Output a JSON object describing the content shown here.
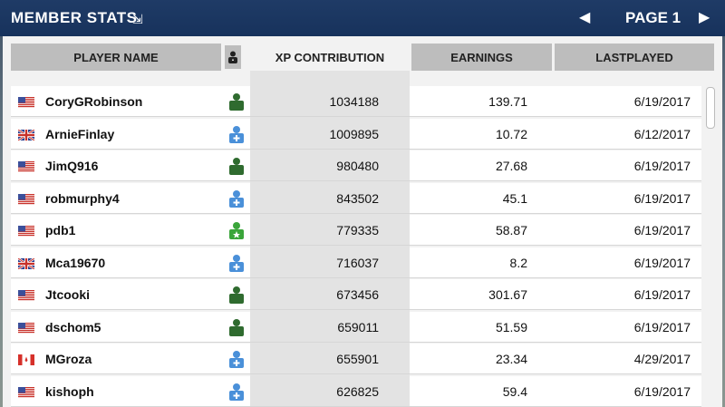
{
  "header": {
    "title": "MEMBER STATS",
    "title_icon": "expand-arrow-icon",
    "page_label": "PAGE 1",
    "prev_icon": "previous-page-icon",
    "next_icon": "next-page-icon"
  },
  "columns": {
    "player_name": "PLAYER NAME",
    "status_icon": "member-status-icon",
    "xp": "XP CONTRIBUTION",
    "earnings": "EARNINGS",
    "last_played": "LASTPLAYED"
  },
  "colors": {
    "topbar": "#1f3b66",
    "header_bg": "#bdbdbd",
    "selected_col": "#e3e3e3",
    "member_green": "#2f6b2f",
    "leader_green": "#3aa53a",
    "recruit_blue": "#4a90d9"
  },
  "rows": [
    {
      "flag": "us-flag-icon",
      "name": "CoryGRobinson",
      "status": "member",
      "xp": "1034188",
      "earnings": "139.71",
      "last": "6/19/2017"
    },
    {
      "flag": "uk-flag-icon",
      "name": "ArnieFinlay",
      "status": "recruit",
      "xp": "1009895",
      "earnings": "10.72",
      "last": "6/12/2017"
    },
    {
      "flag": "us-flag-icon",
      "name": "JimQ916",
      "status": "member",
      "xp": "980480",
      "earnings": "27.68",
      "last": "6/19/2017"
    },
    {
      "flag": "us-flag-icon",
      "name": "robmurphy4",
      "status": "recruit",
      "xp": "843502",
      "earnings": "45.1",
      "last": "6/19/2017"
    },
    {
      "flag": "us-flag-icon",
      "name": "pdb1",
      "status": "leader",
      "xp": "779335",
      "earnings": "58.87",
      "last": "6/19/2017"
    },
    {
      "flag": "uk-flag-icon",
      "name": "Mca19670",
      "status": "recruit",
      "xp": "716037",
      "earnings": "8.2",
      "last": "6/19/2017"
    },
    {
      "flag": "us-flag-icon",
      "name": "Jtcooki",
      "status": "member",
      "xp": "673456",
      "earnings": "301.67",
      "last": "6/19/2017"
    },
    {
      "flag": "us-flag-icon",
      "name": "dschom5",
      "status": "member",
      "xp": "659011",
      "earnings": "51.59",
      "last": "6/19/2017"
    },
    {
      "flag": "ca-flag-icon",
      "name": "MGroza",
      "status": "recruit",
      "xp": "655901",
      "earnings": "23.34",
      "last": "4/29/2017"
    },
    {
      "flag": "us-flag-icon",
      "name": "kishoph",
      "status": "recruit",
      "xp": "626825",
      "earnings": "59.4",
      "last": "6/19/2017"
    }
  ]
}
